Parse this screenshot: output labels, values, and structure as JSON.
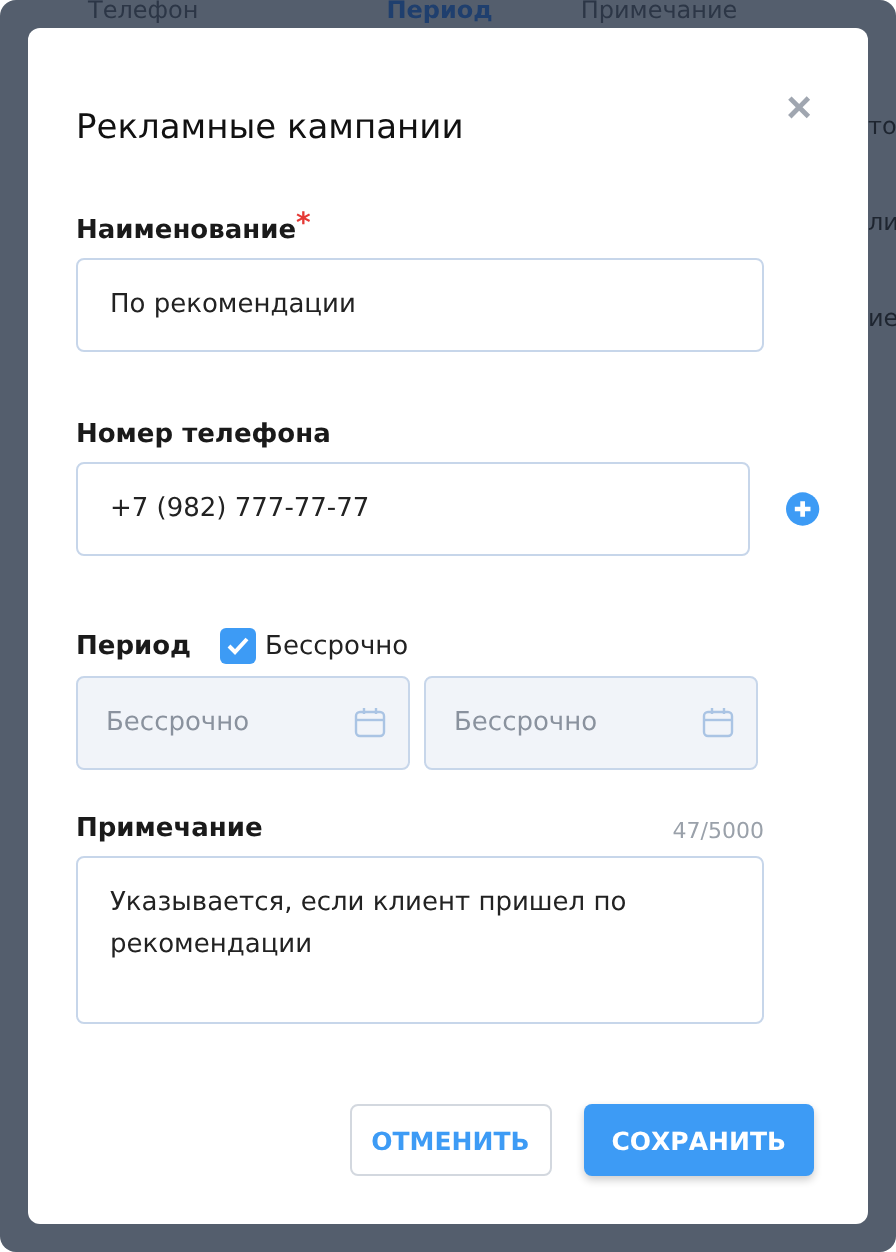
{
  "background": {
    "columns": [
      {
        "label": "Телефон",
        "selected": false
      },
      {
        "label": "Период",
        "selected": true
      },
      {
        "label": "Примечание",
        "selected": false
      }
    ],
    "row_fragments": [
      "то",
      "ли",
      "ие"
    ]
  },
  "dialog": {
    "title": "Рекламные кампании",
    "close": "×",
    "name": {
      "label": "Наименование",
      "required_mark": "*",
      "value": "По рекомендации"
    },
    "phone": {
      "label": "Номер телефона",
      "value": "+7 (982) 777-77-77"
    },
    "period": {
      "label": "Период",
      "checkbox": {
        "label": "Бессрочно",
        "checked": true
      },
      "disabled": true,
      "start": {
        "placeholder": "Бессрочно"
      },
      "end": {
        "placeholder": "Бессрочно"
      }
    },
    "note": {
      "label": "Примечание",
      "counter": "47/5000",
      "value": "Указывается, если клиент пришел по рекомендации"
    },
    "buttons": [
      {
        "label": "ОТМЕНИТЬ",
        "kind": "secondary"
      },
      {
        "label": "СОХРАНИТЬ",
        "kind": "primary"
      }
    ]
  }
}
